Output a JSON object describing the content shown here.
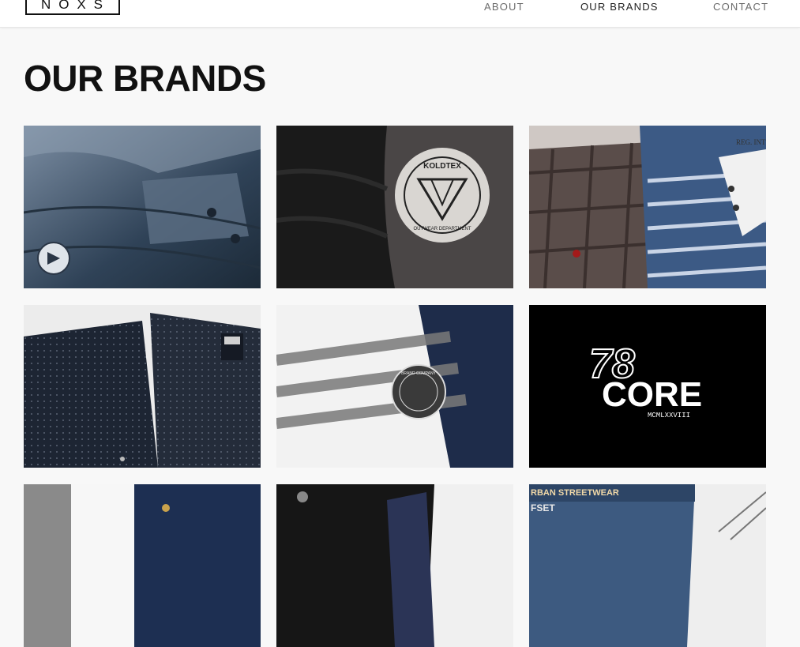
{
  "header": {
    "logo_letters": [
      "N",
      "O",
      "X",
      "S"
    ],
    "nav": [
      {
        "label": "ABOUT",
        "active": false
      },
      {
        "label": "OUR BRANDS",
        "active": true
      },
      {
        "label": "CONTACT",
        "active": false
      }
    ]
  },
  "main": {
    "title": "OUR BRANDS",
    "tiles": [
      {
        "logo_text": "",
        "subject": "denim puffer jacket"
      },
      {
        "logo_text": "KOLDTEX",
        "logo_subtext": "OUTWEAR DEPARTMENT",
        "subject": "black jacket with badge"
      },
      {
        "logo_text": "REG. INT",
        "subject": "plaid shirt and striped tee"
      },
      {
        "logo_text": "",
        "subject": "dark dotted shirts"
      },
      {
        "logo_text": "BRAND COMPANY",
        "subject": "striped shirt and jeans"
      },
      {
        "logo_text": "78",
        "logo_text2": "CORE",
        "logo_subtext": "MCMLXXVIII",
        "subject": "78 CORE logo"
      },
      {
        "logo_text": "",
        "subject": "jeans and white tee"
      },
      {
        "logo_text": "",
        "subject": "black jeans"
      },
      {
        "logo_text": "RBAN STREETWEAR",
        "logo_subtext": "FSET",
        "subject": "patterned denim"
      }
    ]
  },
  "colors": {
    "background": "#f8f8f8",
    "header_bg": "#ffffff",
    "nav_text": "#6b6b6b",
    "nav_active": "#222222",
    "title": "#111111"
  }
}
